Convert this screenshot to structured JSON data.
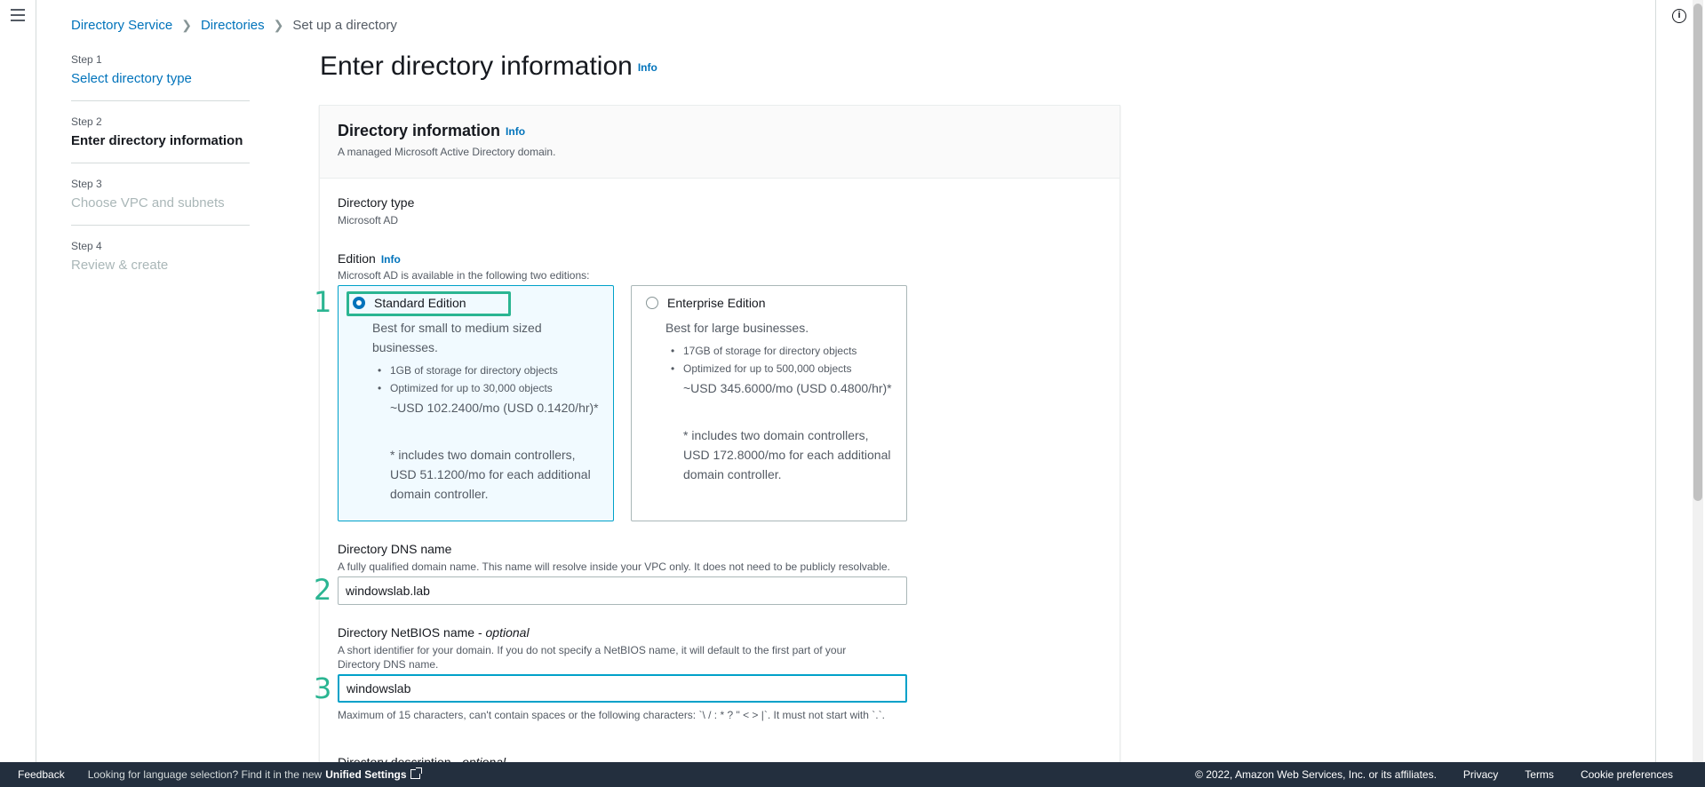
{
  "breadcrumb": {
    "items": [
      "Directory Service",
      "Directories"
    ],
    "current": "Set up a directory"
  },
  "steps": [
    {
      "num": "Step 1",
      "label": "Select directory type"
    },
    {
      "num": "Step 2",
      "label": "Enter directory information"
    },
    {
      "num": "Step 3",
      "label": "Choose VPC and subnets"
    },
    {
      "num": "Step 4",
      "label": "Review & create"
    }
  ],
  "page": {
    "title": "Enter directory information",
    "info": "Info"
  },
  "panel": {
    "title": "Directory information",
    "info": "Info",
    "description": "A managed Microsoft Active Directory domain."
  },
  "directory_type": {
    "label": "Directory type",
    "value": "Microsoft AD"
  },
  "edition": {
    "label": "Edition",
    "info": "Info",
    "description": "Microsoft AD is available in the following two editions:",
    "options": [
      {
        "title": "Standard Edition",
        "subtitle": "Best for small to medium sized businesses.",
        "bullets": [
          "1GB of storage for directory objects",
          "Optimized for up to 30,000 objects"
        ],
        "price": "~USD 102.2400/mo (USD 0.1420/hr)*",
        "note": "* includes two domain controllers, USD 51.1200/mo for each additional domain controller."
      },
      {
        "title": "Enterprise Edition",
        "subtitle": "Best for large businesses.",
        "bullets": [
          "17GB of storage for directory objects",
          "Optimized for up to 500,000 objects"
        ],
        "price": "~USD 345.6000/mo (USD 0.4800/hr)*",
        "note": "* includes two domain controllers, USD 172.8000/mo for each additional domain controller."
      }
    ],
    "selected": "Standard Edition"
  },
  "dns_name": {
    "label": "Directory DNS name",
    "description": "A fully qualified domain name. This name will resolve inside your VPC only. It does not need to be publicly resolvable.",
    "value": "windowslab.lab"
  },
  "netbios": {
    "label": "Directory NetBIOS name",
    "optional": "optional",
    "description": "A short identifier for your domain. If you do not specify a NetBIOS name, it will default to the first part of your Directory DNS name.",
    "value": "windowslab",
    "constraint": "Maximum of 15 characters, can't contain spaces or the following characters: `\\ / : * ? \" < > |`. It must not start with `.`."
  },
  "description_field": {
    "label": "Directory description",
    "optional": "optional"
  },
  "annotations": [
    "1",
    "2",
    "3"
  ],
  "footer": {
    "feedback": "Feedback",
    "lang_text": "Looking for language selection? Find it in the new",
    "unified": "Unified Settings",
    "copyright": "© 2022, Amazon Web Services, Inc. or its affiliates.",
    "privacy": "Privacy",
    "terms": "Terms",
    "cookies": "Cookie preferences"
  },
  "icons": {
    "menu": "menu-icon",
    "info": "info-icon",
    "external_link": "external-link-icon",
    "chevron": "chevron-right-icon"
  },
  "colors": {
    "link": "#0073bb",
    "selected_tile_border": "#00a1c9",
    "selected_tile_bg": "#f1faff",
    "annotation": "#2bb592",
    "footer_bg": "#232f3e"
  }
}
